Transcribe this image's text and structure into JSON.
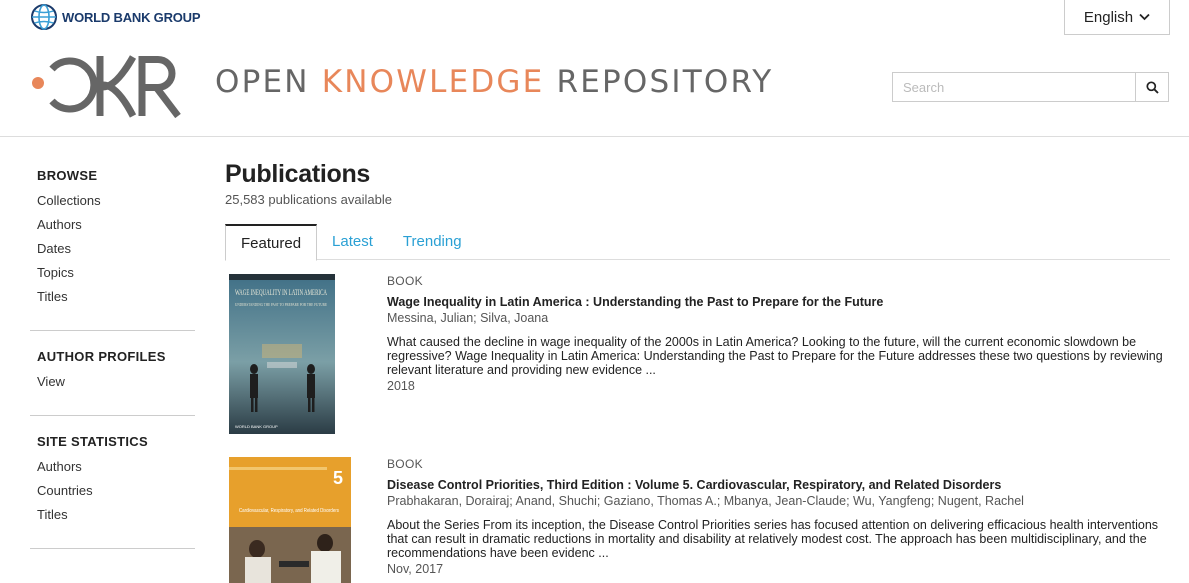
{
  "header": {
    "org_name": "WORLD BANK GROUP",
    "language": "English",
    "repo_title_part1": "OPEN ",
    "repo_title_accent": "KNOWLEDGE",
    "repo_title_part2": " REPOSITORY",
    "search_placeholder": "Search",
    "colors": {
      "accent": "#e8875a",
      "link": "#2aa0d4",
      "logo_gray": "#666666",
      "wbg_blue": "#1a3a6b"
    }
  },
  "sidebar": {
    "browse": {
      "heading": "BROWSE",
      "items": [
        "Collections",
        "Authors",
        "Dates",
        "Topics",
        "Titles"
      ]
    },
    "author_profiles": {
      "heading": "AUTHOR PROFILES",
      "items": [
        "View"
      ]
    },
    "site_statistics": {
      "heading": "SITE STATISTICS",
      "items": [
        "Authors",
        "Countries",
        "Titles"
      ]
    }
  },
  "main": {
    "title": "Publications",
    "count": "25,583 publications available",
    "tabs": [
      {
        "label": "Featured",
        "active": true
      },
      {
        "label": "Latest",
        "active": false
      },
      {
        "label": "Trending",
        "active": false
      }
    ],
    "items": [
      {
        "type": "BOOK",
        "title": "Wage Inequality in Latin America : Understanding the Past to Prepare for the Future",
        "authors": "Messina, Julian; Silva, Joana",
        "abstract": "What caused the decline in wage inequality of the 2000s in Latin America? Looking to the future, will the current economic slowdown be regressive? Wage Inequality in Latin America: Understanding the Past to Prepare for the Future addresses these two questions by reviewing relevant literature and providing new evidence ...",
        "date": "2018",
        "cover_title": "WAGE INEQUALITY IN LATIN AMERICA",
        "cover_subtitle": "UNDERSTANDING THE PAST TO PREPARE FOR THE FUTURE",
        "cover_publisher": "WORLD BANK GROUP"
      },
      {
        "type": "BOOK",
        "title": "Disease Control Priorities, Third Edition : Volume 5. Cardiovascular, Respiratory, and Related Disorders",
        "authors": "Prabhakaran, Dorairaj; Anand, Shuchi; Gaziano, Thomas A.; Mbanya, Jean-Claude; Wu, Yangfeng; Nugent, Rachel",
        "abstract": "About the Series From its inception, the Disease Control Priorities series has focused attention on delivering efficacious health interventions that can result in dramatic reductions in mortality and disability at relatively modest cost. The approach has been multidisciplinary, and the recommendations have been evidenc ...",
        "date": "Nov, 2017",
        "cover_volume": "5",
        "cover_title": "Cardiovascular, Respiratory, and Related Disorders"
      }
    ]
  }
}
